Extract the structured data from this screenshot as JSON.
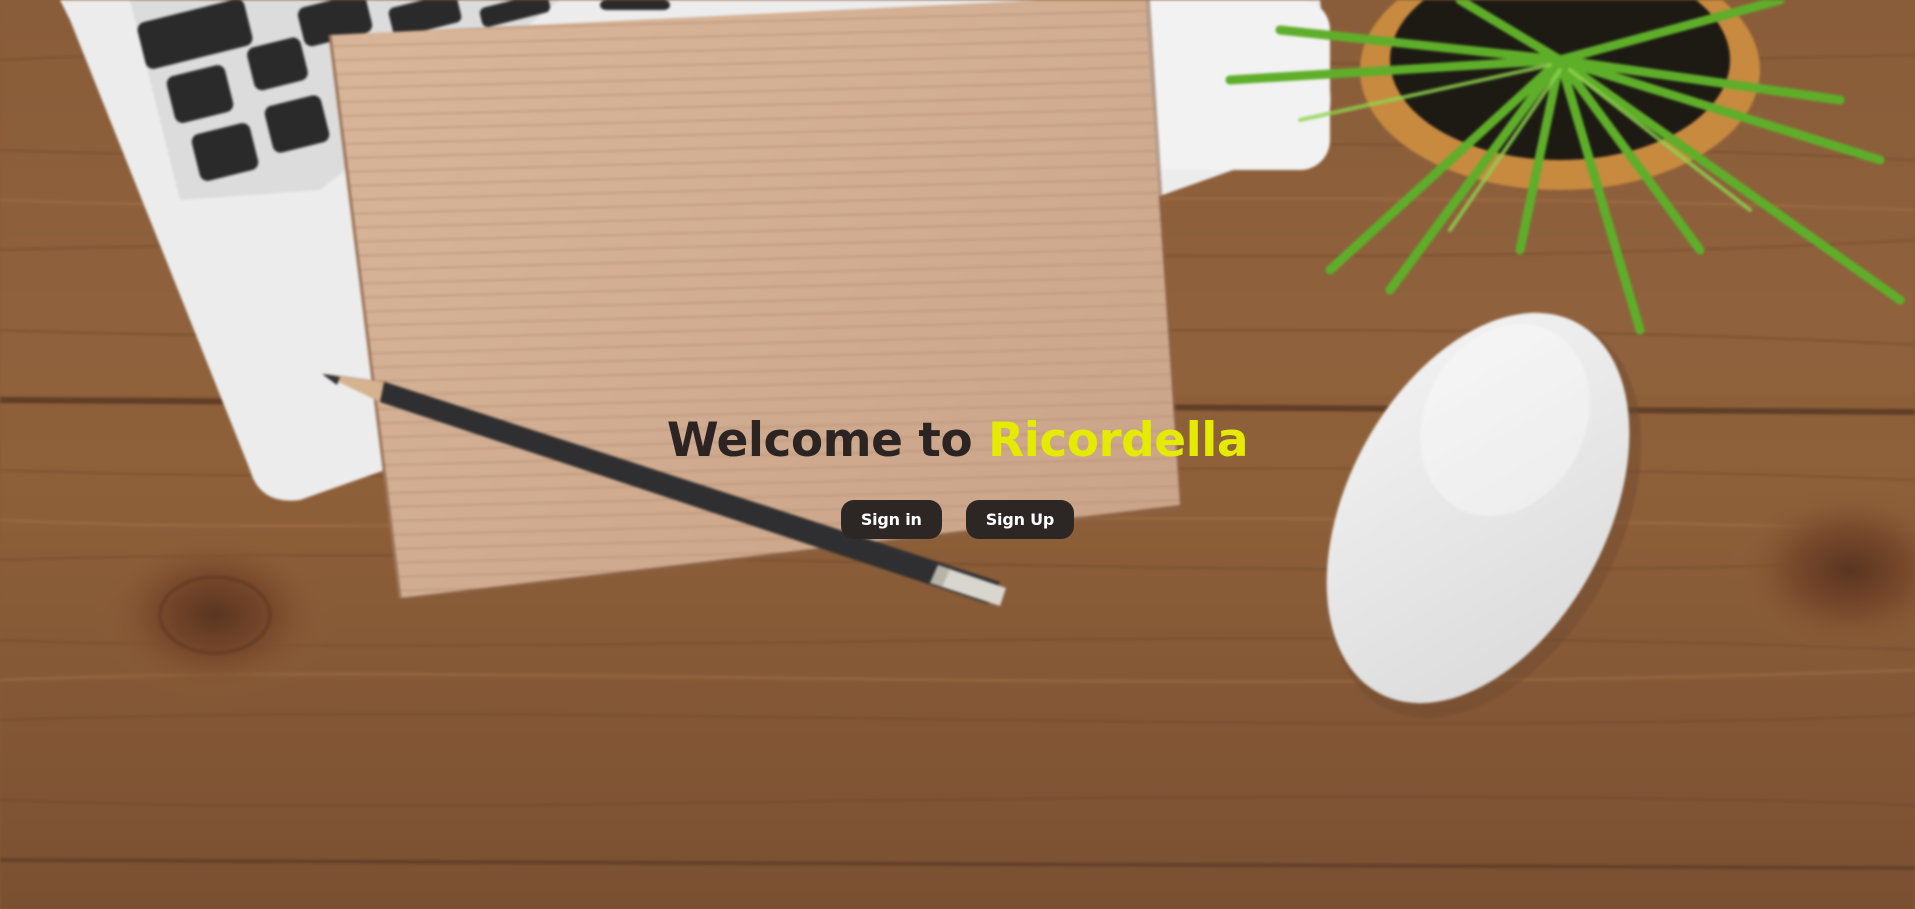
{
  "hero": {
    "title_prefix": "Welcome to",
    "brand": "Ricordella",
    "brand_color": "#e4ea00",
    "title_color": "#2b2422"
  },
  "actions": {
    "sign_in_label": "Sign in",
    "sign_up_label": "Sign Up"
  },
  "background": {
    "description_icons": [
      "laptop-keyboard",
      "notebook",
      "pencil",
      "plant",
      "mouse"
    ]
  }
}
